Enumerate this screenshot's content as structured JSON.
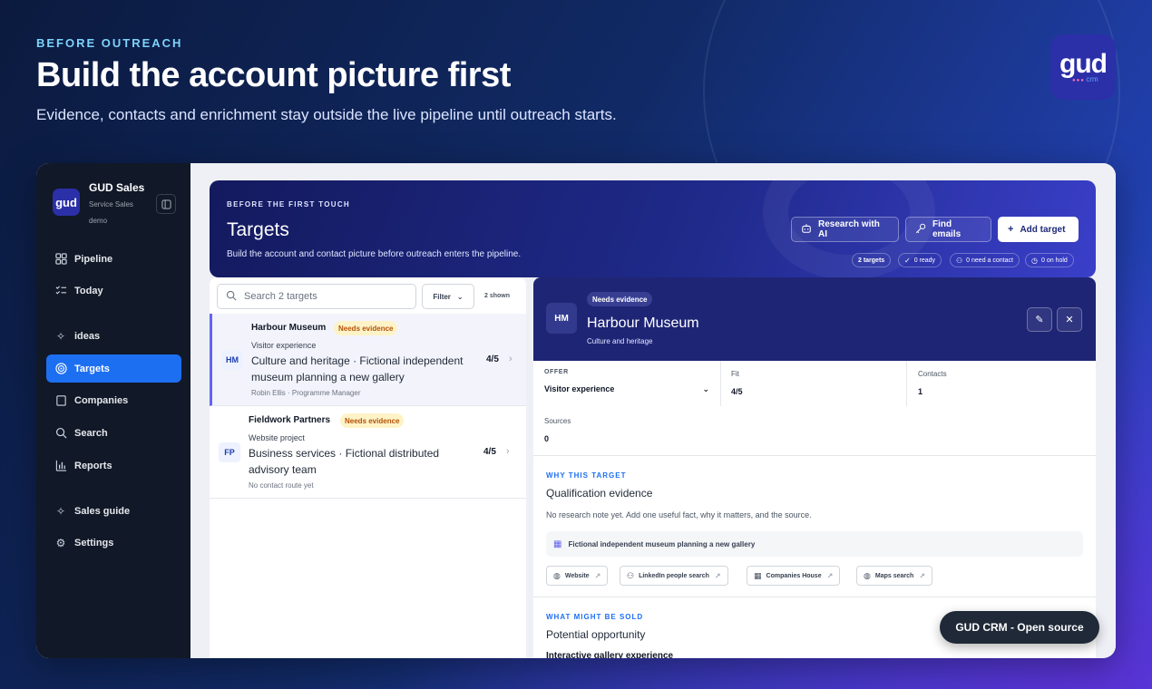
{
  "hero": {
    "eyebrow": "BEFORE OUTREACH",
    "title": "Build the account picture first",
    "subtitle": "Evidence, contacts and enrichment stay outside the live pipeline until outreach starts."
  },
  "brand": {
    "logo_main": "gud",
    "logo_sub": "crm",
    "icon": "gud-crm-logo"
  },
  "sidebar": {
    "logo": "gud",
    "app_name": "GUD Sales",
    "workspace": "Service Sales",
    "mode": "demo",
    "items": [
      {
        "label": "Pipeline",
        "icon": "pipeline-grid-icon"
      },
      {
        "label": "Today",
        "icon": "checklist-icon"
      },
      {
        "label": "ideas",
        "icon": "sparkles-icon"
      },
      {
        "label": "Targets",
        "icon": "target-icon",
        "active": true
      },
      {
        "label": "Companies",
        "icon": "building-icon"
      },
      {
        "label": "Search",
        "icon": "search-icon"
      },
      {
        "label": "Reports",
        "icon": "bar-chart-icon"
      },
      {
        "label": "Sales guide",
        "icon": "sparkles-icon"
      },
      {
        "label": "Settings",
        "icon": "gear-icon"
      }
    ]
  },
  "banner": {
    "eyebrow": "BEFORE THE FIRST TOUCH",
    "title": "Targets",
    "subtitle": "Build the account and contact picture before outreach enters the pipeline.",
    "buttons": {
      "research": "Research with AI",
      "find_emails": "Find emails",
      "add_target": "Add target"
    },
    "chips": {
      "targets": "2 targets",
      "ready": "0 ready",
      "need_contact": "0 need a contact",
      "on_hold": "0 on hold"
    }
  },
  "list": {
    "search_placeholder": "Search 2 targets",
    "filter_label": "Filter",
    "shown_label": "2 shown",
    "rows": [
      {
        "initials": "HM",
        "name": "Harbour Museum",
        "badge": "Needs evidence",
        "offer": "Visitor experience",
        "description": "Culture and heritage · Fictional independent museum planning a new gallery",
        "contact": "Robin Ellis · Programme Manager",
        "score": "4/5"
      },
      {
        "initials": "FP",
        "name": "Fieldwork Partners",
        "badge": "Needs evidence",
        "offer": "Website project",
        "description": "Business services · Fictional distributed advisory team",
        "contact": "No contact route yet",
        "score": "4/5"
      }
    ]
  },
  "detail": {
    "initials": "HM",
    "badge": "Needs evidence",
    "title": "Harbour Museum",
    "subtitle": "Culture and heritage",
    "fields": {
      "offer_label": "OFFER",
      "offer_value": "Visitor experience",
      "fit_label": "Fit",
      "fit_value": "4/5",
      "contacts_label": "Contacts",
      "contacts_value": "1",
      "sources_label": "Sources",
      "sources_value": "0"
    },
    "why": {
      "eyebrow": "WHY THIS TARGET",
      "title": "Qualification evidence",
      "note": "No research note yet. Add one useful fact, why it matters, and the source.",
      "evidence": "Fictional independent museum planning a new gallery"
    },
    "links": [
      "Website",
      "LinkedIn people search",
      "Companies House",
      "Maps search"
    ],
    "sold": {
      "eyebrow": "WHAT MIGHT BE SOLD",
      "title": "Potential opportunity",
      "item": "Interactive gallery experience"
    }
  },
  "toast": "GUD CRM - Open source",
  "colors": {
    "accent": "#1d6ff2",
    "sidebar_bg": "#111827",
    "banner_bg": "#1f2575",
    "badge_bg": "#fef3c7",
    "badge_text": "#b45309"
  }
}
